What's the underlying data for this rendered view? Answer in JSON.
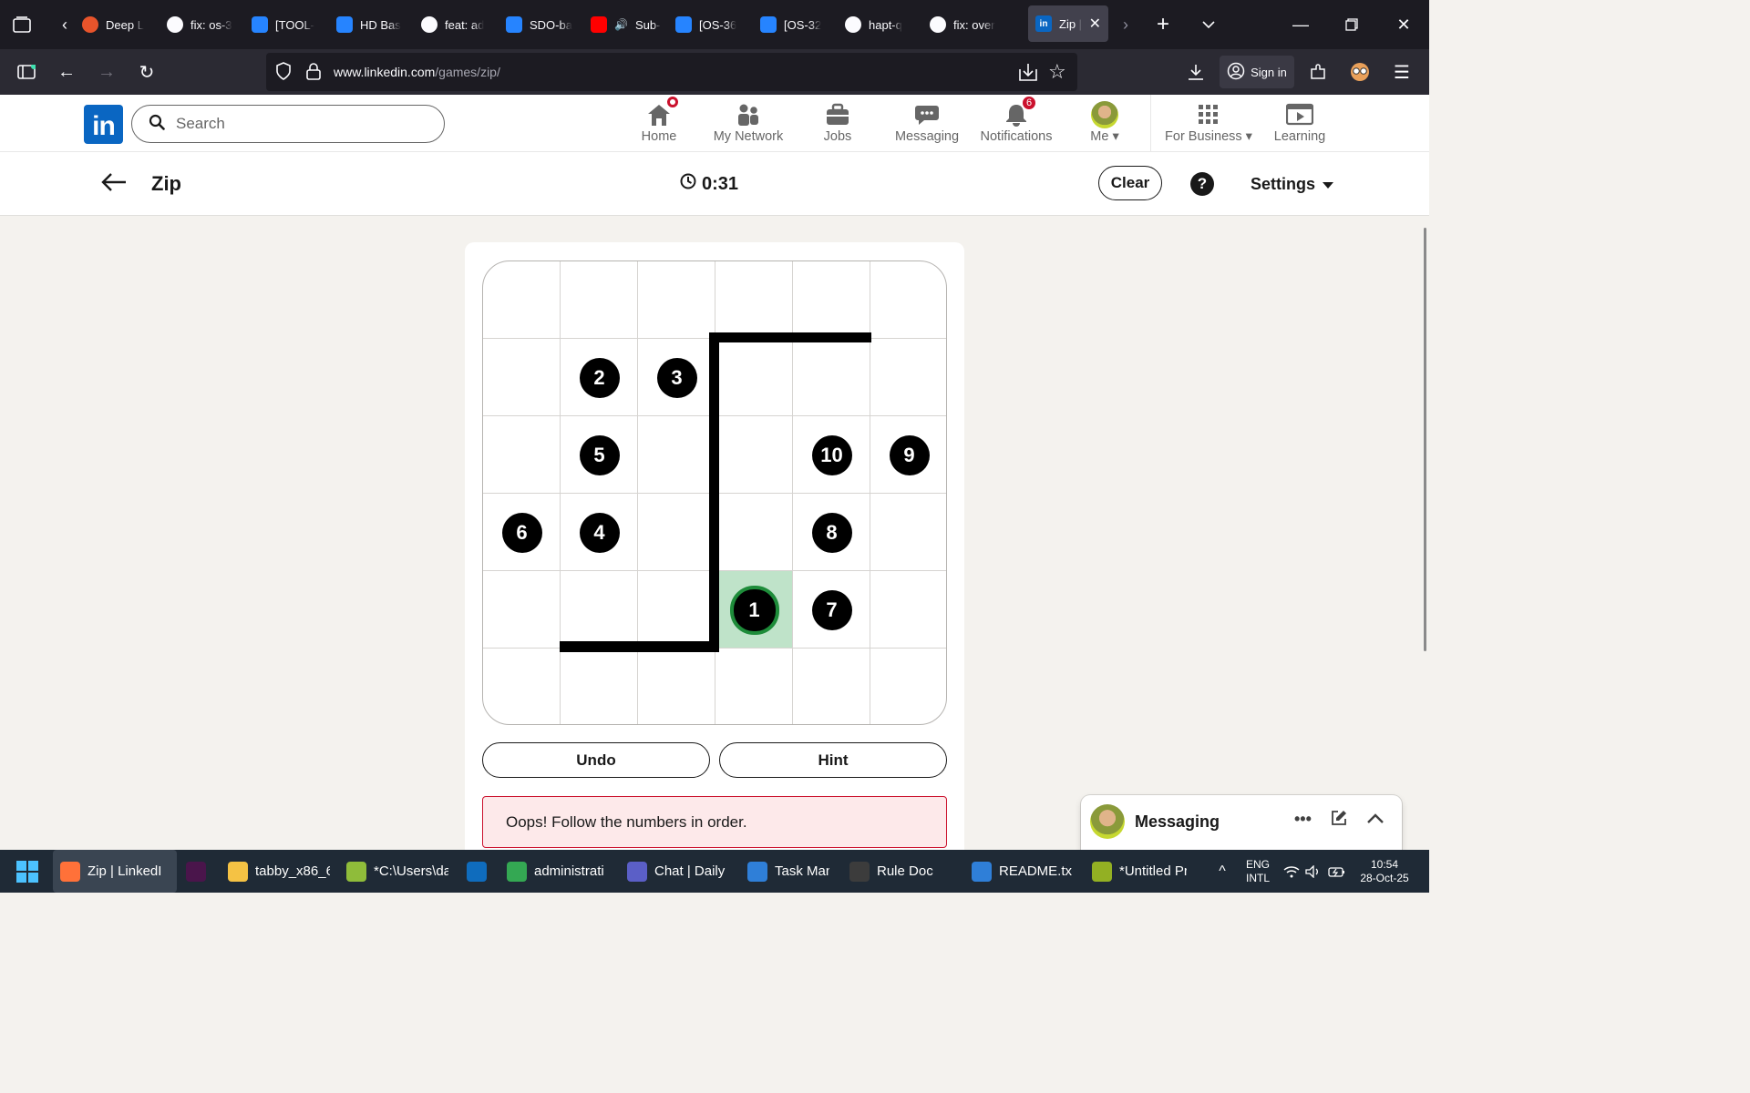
{
  "browser": {
    "tabs": [
      {
        "label": "Deep L",
        "icon": "deepl-icon",
        "color": "#e8542b"
      },
      {
        "label": "fix: os-3",
        "icon": "github-icon",
        "color": "#ffffff"
      },
      {
        "label": "[TOOL-",
        "icon": "jira-icon",
        "color": "#2684ff"
      },
      {
        "label": "HD Bas",
        "icon": "confluence-icon",
        "color": "#2684ff"
      },
      {
        "label": "feat: ad",
        "icon": "github-icon",
        "color": "#ffffff"
      },
      {
        "label": "SDO-ba",
        "icon": "confluence-icon",
        "color": "#2684ff"
      },
      {
        "label": "Sub-Sta",
        "icon": "youtube-icon",
        "color": "#ff0000"
      },
      {
        "label": "[OS-36",
        "icon": "jira-icon",
        "color": "#2684ff"
      },
      {
        "label": "[OS-32",
        "icon": "jira-icon",
        "color": "#2684ff"
      },
      {
        "label": "hapt-q",
        "icon": "github-icon",
        "color": "#ffffff"
      },
      {
        "label": "fix: over",
        "icon": "github-icon",
        "color": "#ffffff"
      }
    ],
    "active_tab": {
      "label": "Zip | ",
      "icon": "linkedin-icon"
    },
    "url_domain": "www.linkedin.com",
    "url_path": "/games/zip/",
    "sign_in": "Sign in"
  },
  "linkedin": {
    "logo": "in",
    "search_placeholder": "Search",
    "nav": [
      {
        "label": "Home",
        "icon": "home-icon",
        "badge": "dot"
      },
      {
        "label": "My Network",
        "icon": "network-icon"
      },
      {
        "label": "Jobs",
        "icon": "briefcase-icon"
      },
      {
        "label": "Messaging",
        "icon": "messaging-icon"
      },
      {
        "label": "Notifications",
        "icon": "bell-icon",
        "badge": "6"
      },
      {
        "label": "Me",
        "icon": "avatar"
      },
      {
        "label": "For Business",
        "icon": "grid-icon"
      },
      {
        "label": "Learning",
        "icon": "learning-icon"
      }
    ]
  },
  "game": {
    "title": "Zip",
    "timer": "0:31",
    "clear_label": "Clear",
    "help_label": "?",
    "settings_label": "Settings",
    "grid_size": 6,
    "numbers": [
      {
        "n": "1",
        "row": 4,
        "col": 3,
        "start": true
      },
      {
        "n": "2",
        "row": 1,
        "col": 1
      },
      {
        "n": "3",
        "row": 1,
        "col": 2
      },
      {
        "n": "4",
        "row": 3,
        "col": 1
      },
      {
        "n": "5",
        "row": 2,
        "col": 1
      },
      {
        "n": "6",
        "row": 3,
        "col": 0
      },
      {
        "n": "7",
        "row": 4,
        "col": 4
      },
      {
        "n": "8",
        "row": 3,
        "col": 4
      },
      {
        "n": "9",
        "row": 2,
        "col": 5
      },
      {
        "n": "10",
        "row": 2,
        "col": 4
      }
    ],
    "highlighted_cell": {
      "row": 4,
      "col": 3
    },
    "undo_label": "Undo",
    "hint_label": "Hint",
    "error_message": "Oops! Follow the numbers in order."
  },
  "messaging": {
    "title": "Messaging"
  },
  "taskbar": {
    "items": [
      {
        "label": "Zip | LinkedI",
        "icon": "firefox-icon",
        "color": "#ff7139",
        "active": true
      },
      {
        "label": "",
        "icon": "slack-icon",
        "color": "#4a154b"
      },
      {
        "label": "tabby_x86_6",
        "icon": "folder-icon",
        "color": "#f5c244"
      },
      {
        "label": "*C:\\Users\\da",
        "icon": "notepadpp-icon",
        "color": "#8fbc3a"
      },
      {
        "label": "",
        "icon": "outlook-icon",
        "color": "#0f6cbd"
      },
      {
        "label": "administrati",
        "icon": "chrome-icon",
        "color": "#34a853"
      },
      {
        "label": "Chat | Daily",
        "icon": "teams-icon",
        "color": "#5b5fc7"
      },
      {
        "label": "Task Man",
        "icon": "task-manager-icon",
        "color": "#2f7fd8"
      },
      {
        "label": "Rule Doc",
        "icon": "terminal-icon",
        "color": "#3c3c3c"
      },
      {
        "label": "README.txt",
        "icon": "notepad-icon",
        "color": "#2f7fd8"
      },
      {
        "label": "*Untitled Pr",
        "icon": "qgis-icon",
        "color": "#93b023"
      }
    ],
    "lang_top": "ENG",
    "lang_bottom": "INTL",
    "time": "10:54",
    "date": "28-Oct-25"
  }
}
